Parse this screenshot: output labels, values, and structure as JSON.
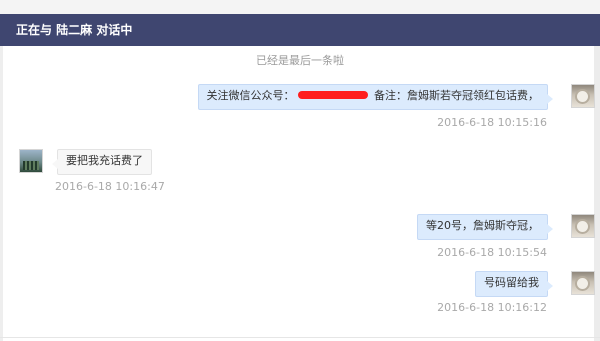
{
  "header": {
    "title": "正在与 陆二麻 对话中"
  },
  "notice": "已经是最后一条啦",
  "messages": [
    {
      "from": "self",
      "text_before": "关注微信公众号：",
      "text_after": " 备注：詹姆斯若夺冠领红包话费，",
      "redacted": true,
      "time": "2016-6-18 10:15:16"
    },
    {
      "from": "other",
      "text": "要把我充话费了",
      "time": "2016-6-18 10:16:47"
    },
    {
      "from": "self",
      "text": "等20号，詹姆斯夺冠，",
      "time": "2016-6-18 10:15:54"
    },
    {
      "from": "self",
      "text": "号码留给我",
      "time": "2016-6-18 10:16:12"
    }
  ],
  "colors": {
    "header_bg": "#3f4670",
    "bubble_out": "#dcebfd",
    "bubble_in": "#f7f7f7",
    "redaction": "#ff1e1e"
  }
}
